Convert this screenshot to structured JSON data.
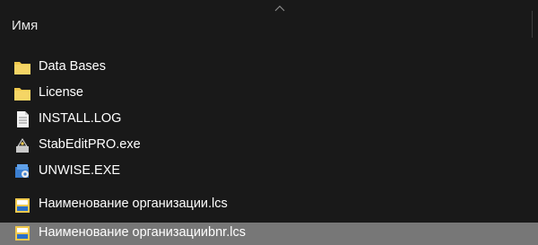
{
  "header": {
    "column_name": "Имя"
  },
  "files": [
    {
      "name": "Data Bases",
      "icon": "folder-icon"
    },
    {
      "name": "License",
      "icon": "folder-icon"
    },
    {
      "name": "INSTALL.LOG",
      "icon": "text-file-icon"
    },
    {
      "name": "StabEditPRO.exe",
      "icon": "app-icon"
    },
    {
      "name": "UNWISE.EXE",
      "icon": "installer-icon"
    },
    {
      "name": "Наименование организации.lcs",
      "icon": "lcs-file-icon"
    },
    {
      "name": "Наименование организацииbnr.lcs",
      "icon": "lcs-file-icon",
      "selected": true
    }
  ],
  "colors": {
    "background": "#191919",
    "selection": "#777777",
    "folder": "#f0c94e",
    "text": "#ffffff"
  }
}
